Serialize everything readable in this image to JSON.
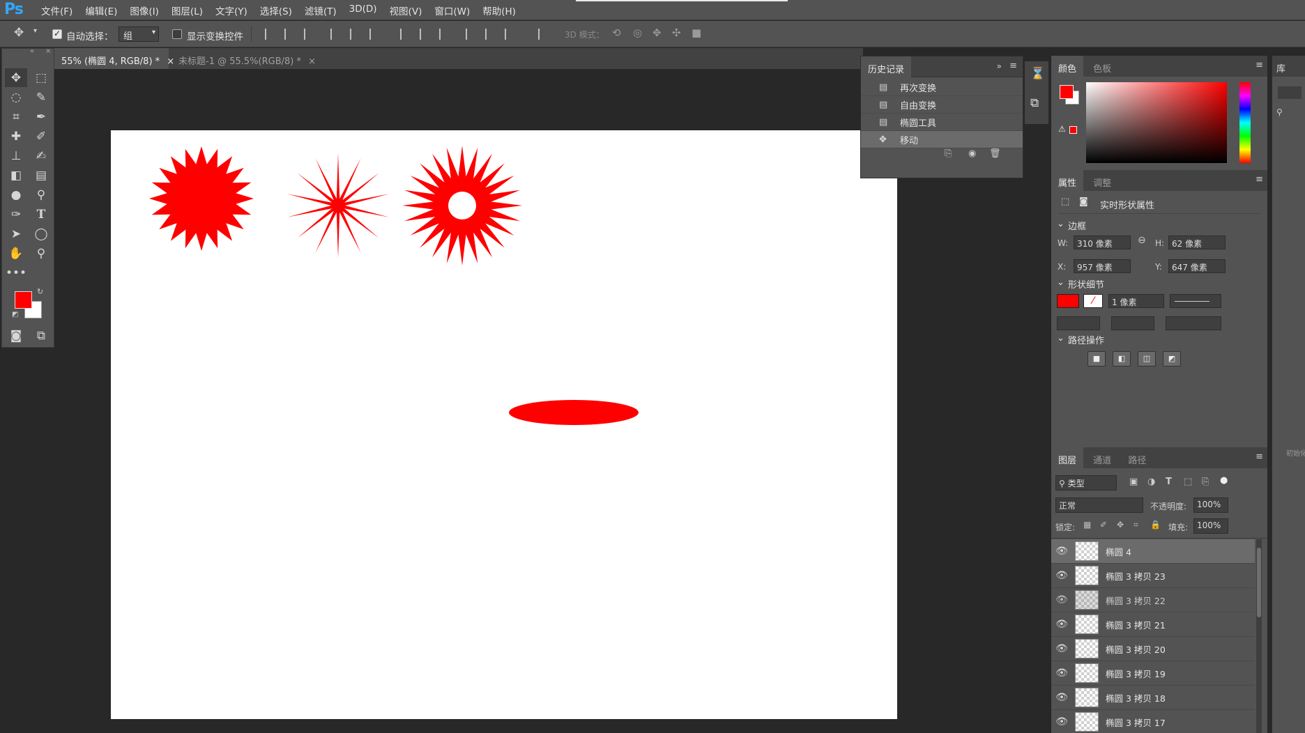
{
  "app": {
    "logo": "Ps"
  },
  "menu": [
    "文件(F)",
    "编辑(E)",
    "图像(I)",
    "图层(L)",
    "文字(Y)",
    "选择(S)",
    "滤镜(T)",
    "3D(D)",
    "视图(V)",
    "窗口(W)",
    "帮助(H)"
  ],
  "options": {
    "auto_select_label": "自动选择：",
    "auto_select_value": "组",
    "show_transform_label": "显示变换控件",
    "mode_3d_label": "3D 模式："
  },
  "tabs": [
    {
      "label": "55% (椭圆 4, RGB/8) *",
      "close": "×"
    },
    {
      "label": "未标题-1 @ 55.5%(RGB/8) *",
      "close": "×"
    }
  ],
  "history": {
    "title": "历史记录",
    "items": [
      "再次变换",
      "自由变换",
      "椭圆工具",
      "移动"
    ],
    "selected_index": 3
  },
  "color_panel": {
    "tabs": [
      "颜色",
      "色板"
    ],
    "foreground": "#ff0000",
    "background": "#ffffff"
  },
  "library_tab": "库",
  "properties": {
    "tabs": [
      "属性",
      "调整"
    ],
    "subtitle": "实时形状属性",
    "section_bounds": "边框",
    "w_label": "W:",
    "w_value": "310 像素",
    "h_label": "H:",
    "h_value": "62 像素",
    "x_label": "X:",
    "x_value": "957 像素",
    "y_label": "Y:",
    "y_value": "647 像素",
    "section_shape": "形状细节",
    "stroke_width": "1 像素",
    "section_path": "路径操作"
  },
  "layers": {
    "tabs": [
      "图层",
      "通道",
      "路径"
    ],
    "filter_label": "类型",
    "blend_mode": "正常",
    "opacity_label": "不透明度:",
    "opacity_value": "100%",
    "lock_label": "锁定:",
    "fill_label": "填充:",
    "fill_value": "100%",
    "items": [
      {
        "name": "椭圆 4",
        "visible": true,
        "selected": true
      },
      {
        "name": "椭圆 3 拷贝 23",
        "visible": true,
        "selected": false
      },
      {
        "name": "椭圆 3 拷贝 22",
        "visible": true,
        "selected": false
      },
      {
        "name": "椭圆 3 拷贝 21",
        "visible": true,
        "selected": false
      },
      {
        "name": "椭圆 3 拷贝 20",
        "visible": true,
        "selected": false
      },
      {
        "name": "椭圆 3 拷贝 19",
        "visible": true,
        "selected": false
      },
      {
        "name": "椭圆 3 拷贝 18",
        "visible": true,
        "selected": false
      },
      {
        "name": "椭圆 3 拷贝 17",
        "visible": true,
        "selected": false
      }
    ]
  },
  "far_right_hint": "初始化",
  "shape_color": "#ff0000"
}
